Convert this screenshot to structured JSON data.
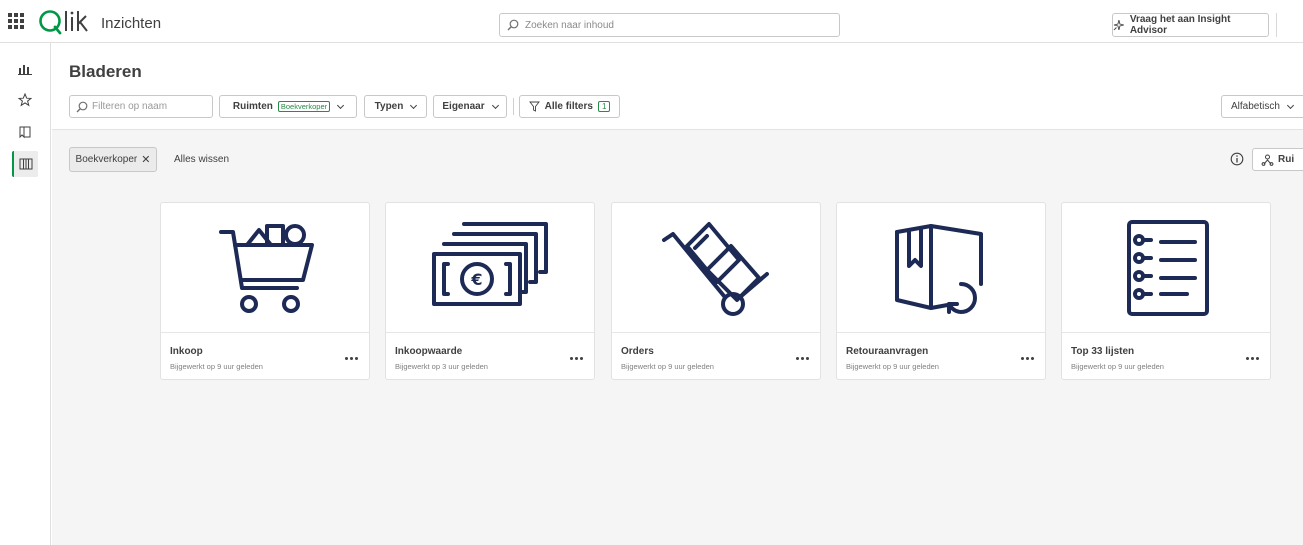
{
  "header": {
    "app_title": "Inzichten",
    "search_placeholder": "Zoeken naar inhoud",
    "insight_label": "Vraag het aan Insight Advisor"
  },
  "rail": {
    "items": [
      {
        "icon": "analytics-icon"
      },
      {
        "icon": "star-icon"
      },
      {
        "icon": "bookmark-icon"
      },
      {
        "icon": "catalog-icon",
        "active": true
      }
    ]
  },
  "main": {
    "title": "Bladeren",
    "filter_placeholder": "Filteren op naam",
    "spaces_label": "Ruimten",
    "spaces_selected": "Boekverkoper",
    "types_label": "Typen",
    "owner_label": "Eigenaar",
    "all_filters_label": "Alle filters",
    "all_filters_count": "1",
    "sort_label": "Alfabetisch",
    "active_filter": "Boekverkoper",
    "clear_all": "Alles wissen",
    "space_button_label": "Rui"
  },
  "cards": [
    {
      "title": "Inkoop",
      "subtitle": "Bijgewerkt op 9 uur geleden",
      "icon": "shopping-cart-icon"
    },
    {
      "title": "Inkoopwaarde",
      "subtitle": "Bijgewerkt op 3 uur geleden",
      "icon": "money-stack-icon"
    },
    {
      "title": "Orders",
      "subtitle": "Bijgewerkt op 9 uur geleden",
      "icon": "hand-truck-icon"
    },
    {
      "title": "Retouraanvragen",
      "subtitle": "Bijgewerkt op 9 uur geleden",
      "icon": "return-box-icon"
    },
    {
      "title": "Top 33 lijsten",
      "subtitle": "Bijgewerkt op 9 uur geleden",
      "icon": "list-icon"
    }
  ],
  "colors": {
    "accent": "#009845",
    "icon": "#1d2a55",
    "filter_bg": "#f5f5f5"
  }
}
